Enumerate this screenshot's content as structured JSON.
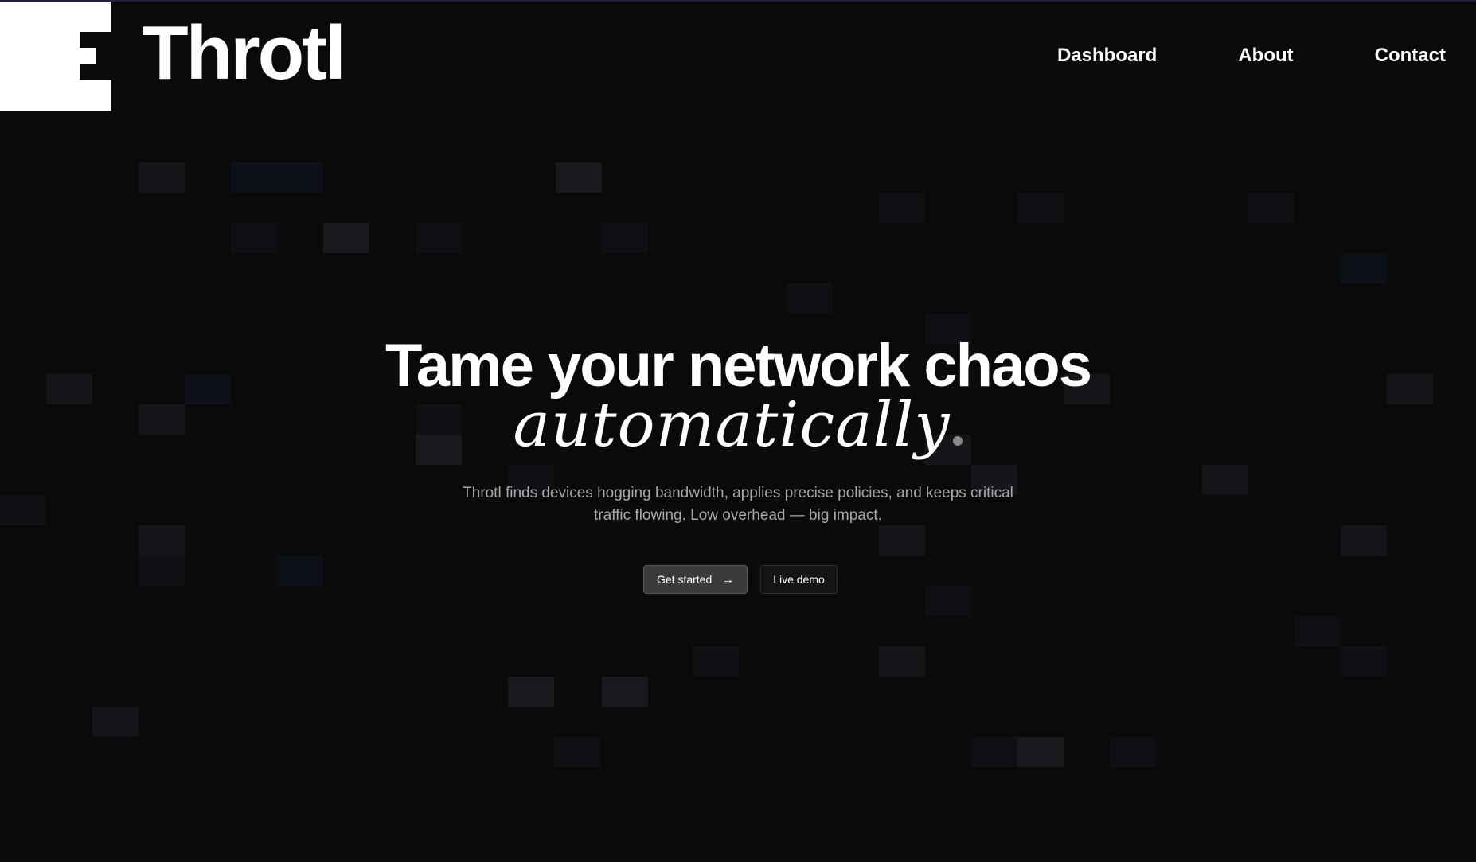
{
  "brand": {
    "name": "Throtl"
  },
  "nav": {
    "items": [
      {
        "label": "Dashboard"
      },
      {
        "label": "About"
      },
      {
        "label": "Contact"
      }
    ]
  },
  "hero": {
    "headline": "Tame your network chaos",
    "script_word": "automatically",
    "subtitle": "Throtl finds devices hogging bandwidth, applies precise policies, and keeps critical traffic flowing. Low overhead — big impact.",
    "primary_button": {
      "label": "Get started",
      "icon": "arrow-right-icon"
    },
    "secondary_button": {
      "label": "Live demo"
    }
  },
  "colors": {
    "background": "#0a0a0b",
    "text": "#ffffff",
    "muted_text": "#a8a8ad",
    "primary_button_bg": "#3b3b3e"
  }
}
